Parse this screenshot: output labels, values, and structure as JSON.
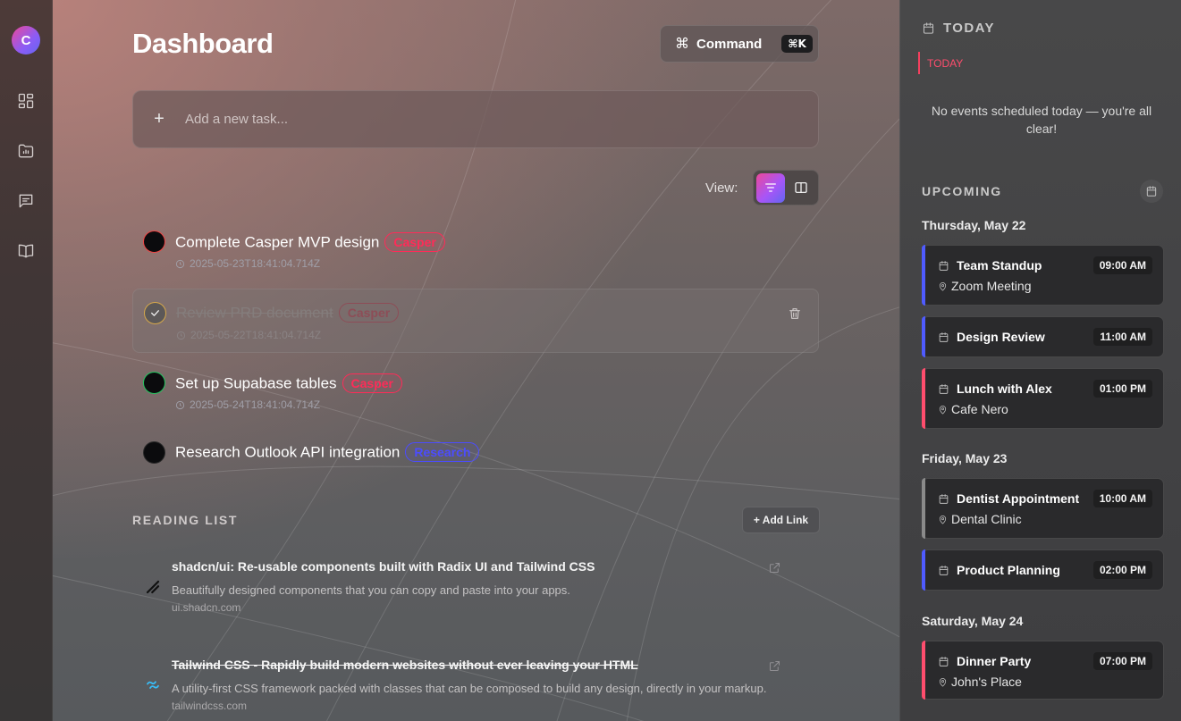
{
  "sidebar": {
    "avatar_letter": "C",
    "items": [
      {
        "name": "dashboard",
        "icon": "grid-icon"
      },
      {
        "name": "projects",
        "icon": "folder-chart-icon"
      },
      {
        "name": "messages",
        "icon": "message-icon"
      },
      {
        "name": "reading",
        "icon": "book-icon"
      }
    ]
  },
  "header": {
    "title": "Dashboard",
    "command_glyph": "⌘",
    "command_label": "Command",
    "command_shortcut": "⌘K"
  },
  "add_task": {
    "plus": "+",
    "placeholder": "Add a new task..."
  },
  "view": {
    "label": "View:",
    "active": "filter"
  },
  "tasks": [
    {
      "title": "Complete Casper MVP design",
      "tag": "Casper",
      "timestamp": "2025-05-23T18:41:04.714Z",
      "done": false,
      "status_color": "#ef4444"
    },
    {
      "title": "Review PRD document",
      "tag": "Casper",
      "timestamp": "2025-05-22T18:41:04.714Z",
      "done": true,
      "status_color": "#d6a84b"
    },
    {
      "title": "Set up Supabase tables",
      "tag": "Casper",
      "timestamp": "2025-05-24T18:41:04.714Z",
      "done": false,
      "status_color": "#22c55e"
    },
    {
      "title": "Research Outlook API integration",
      "tag": "Research",
      "timestamp": "",
      "done": false,
      "status_color": "#2a2a2a"
    }
  ],
  "reading_list": {
    "title": "READING LIST",
    "add_label": "+ Add Link",
    "items": [
      {
        "title": "shadcn/ui: Re-usable components built with Radix UI and Tailwind CSS",
        "description": "Beautifully designed components that you can copy and paste into your apps.",
        "url": "ui.shadcn.com",
        "read": false,
        "logo": "shadcn-logo-icon"
      },
      {
        "title": "Tailwind CSS - Rapidly build modern websites without ever leaving your HTML",
        "description": "A utility-first CSS framework packed with classes that can be composed to build any design, directly in your markup.",
        "url": "tailwindcss.com",
        "read": true,
        "logo": "tailwind-logo-icon"
      }
    ]
  },
  "calendar": {
    "today_heading": "TODAY",
    "today_marker": "TODAY",
    "no_events": "No events scheduled today — you're all clear!",
    "upcoming_heading": "UPCOMING",
    "days": [
      {
        "label": "Thursday, May 22",
        "events": [
          {
            "title": "Team Standup",
            "time": "09:00 AM",
            "location": "Zoom Meeting",
            "color": "#4f5bff"
          },
          {
            "title": "Design Review",
            "time": "11:00 AM",
            "location": "",
            "color": "#4f5bff"
          },
          {
            "title": "Lunch with Alex",
            "time": "01:00 PM",
            "location": "Cafe Nero",
            "color": "#ff4d6d"
          }
        ]
      },
      {
        "label": "Friday, May 23",
        "events": [
          {
            "title": "Dentist Appointment",
            "time": "10:00 AM",
            "location": "Dental Clinic",
            "color": "#8a8a8a"
          },
          {
            "title": "Product Planning",
            "time": "02:00 PM",
            "location": "",
            "color": "#4f5bff"
          }
        ]
      },
      {
        "label": "Saturday, May 24",
        "events": [
          {
            "title": "Dinner Party",
            "time": "07:00 PM",
            "location": "John's Place",
            "color": "#ff4d6d"
          }
        ]
      }
    ]
  }
}
